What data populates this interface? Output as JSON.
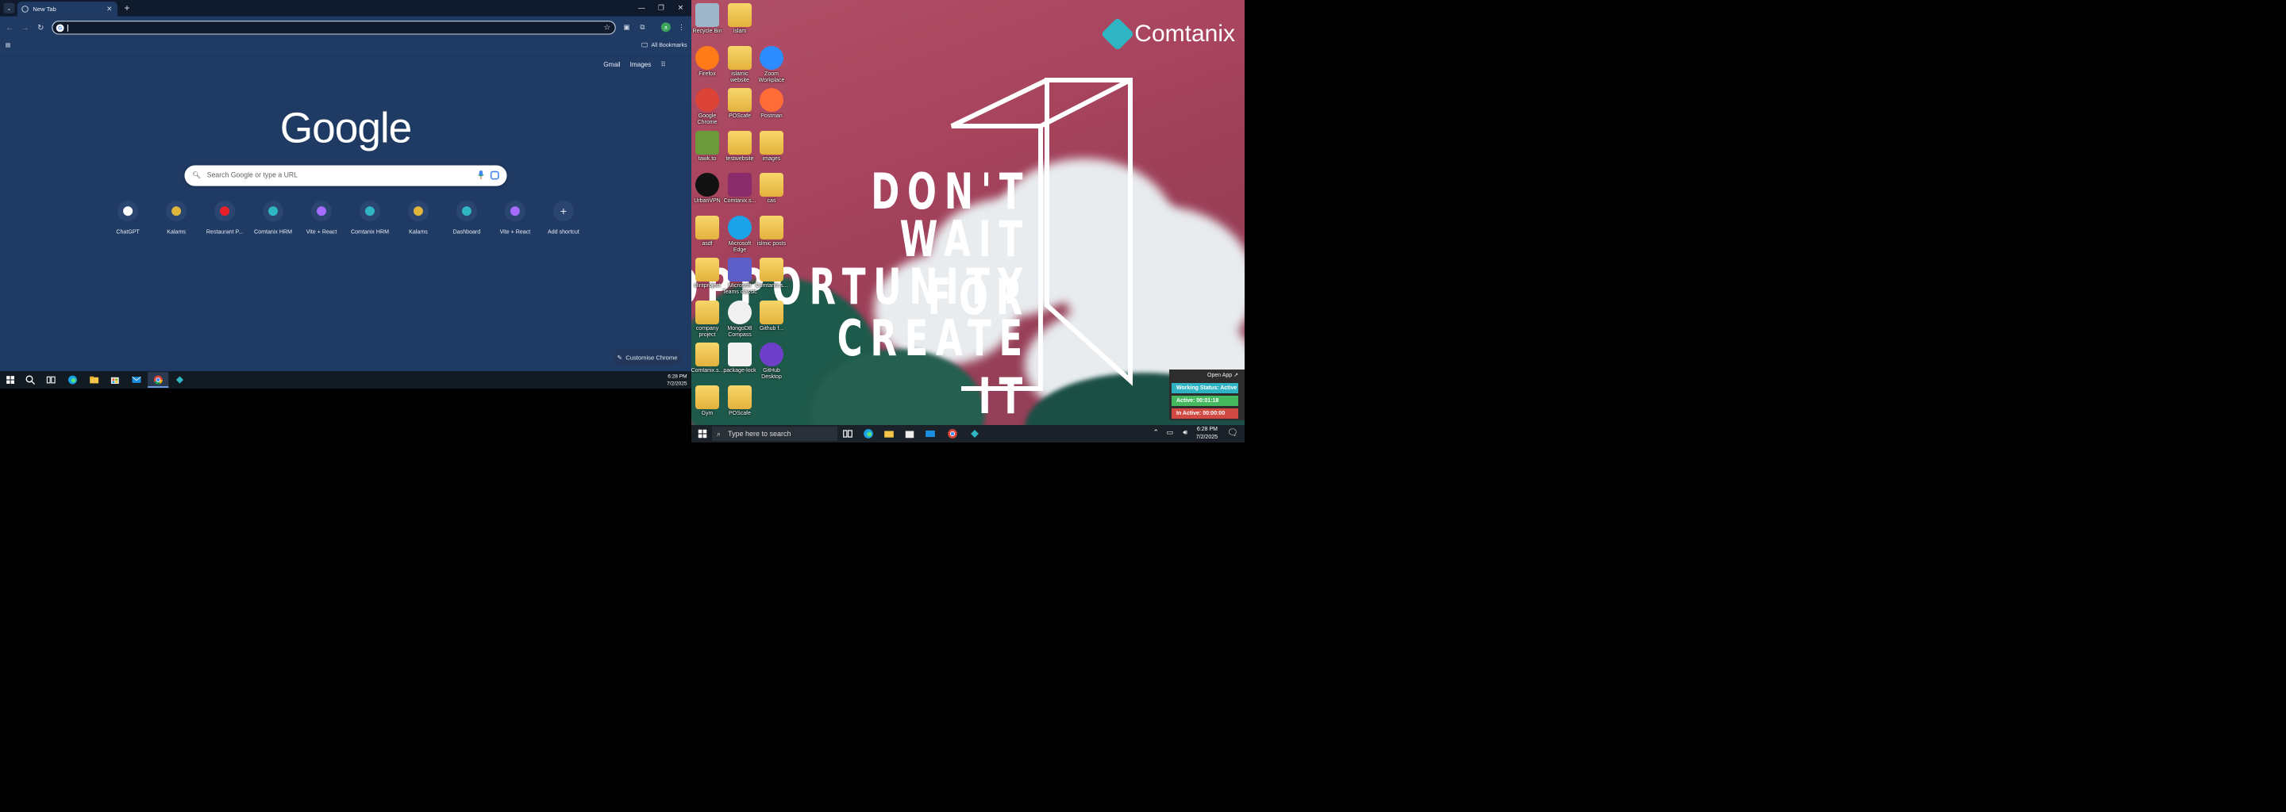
{
  "browser": {
    "tab_title": "New Tab",
    "bookmarks_label": "All Bookmarks",
    "header_links": [
      "Gmail",
      "Images"
    ],
    "logo_text": "Google",
    "search_placeholder": "Search Google or type a URL",
    "customise_label": "Customise Chrome",
    "profile_initial": "a",
    "shortcuts": [
      {
        "label": "ChatGPT",
        "color": "#ffffff"
      },
      {
        "label": "Kalams",
        "color": "#e0b53b"
      },
      {
        "label": "Restaurant P...",
        "color": "#e8202a"
      },
      {
        "label": "Comtanix HRM",
        "color": "#2fb6c2"
      },
      {
        "label": "Vite + React",
        "color": "#a66bff"
      },
      {
        "label": "Comtanix HRM",
        "color": "#2fb6c2"
      },
      {
        "label": "Kalams",
        "color": "#e0b53b"
      },
      {
        "label": "Dashboard",
        "color": "#2fb6c2"
      },
      {
        "label": "Vite + React",
        "color": "#a66bff"
      },
      {
        "label": "Add shortcut",
        "color": "#e7edf6"
      }
    ]
  },
  "left_taskbar": {
    "time": "6:28 PM",
    "date": "7/2/2025"
  },
  "desktop": {
    "brand": "Comtanix",
    "slogan": [
      "DON'T",
      "WAIT FOR",
      "OPPORTUNITY",
      "CREATE IT"
    ],
    "icons": [
      [
        "Recycle Bin",
        "islam",
        ""
      ],
      [
        "Firefox",
        "islamic website",
        "Zoom Workplace"
      ],
      [
        "Google Chrome",
        "POScafe",
        "Postman"
      ],
      [
        "tawk.to",
        "testwebsite",
        "images"
      ],
      [
        "UrbanVPN",
        "Comtanix.s...",
        "cas"
      ],
      [
        "asdf",
        "Microsoft Edge",
        "islmic posts"
      ],
      [
        "clintproject",
        "Microsoft Teams classic",
        "Comtanix.s..."
      ],
      [
        "company project",
        "MongoDB Compass",
        "Github f..."
      ],
      [
        "Comtanix.s...",
        "package-lock",
        "GitHub Desktop"
      ],
      [
        "Gym",
        "POScafe",
        ""
      ]
    ]
  },
  "widget": {
    "open_app": "Open App ↗",
    "status": "Working Status: Active",
    "active": "Active: 00:01:18",
    "inactive": "In Active: 00:00:00"
  },
  "right_taskbar": {
    "search_placeholder": "Type here to search",
    "time": "6:28 PM",
    "date": "7/2/2025"
  }
}
